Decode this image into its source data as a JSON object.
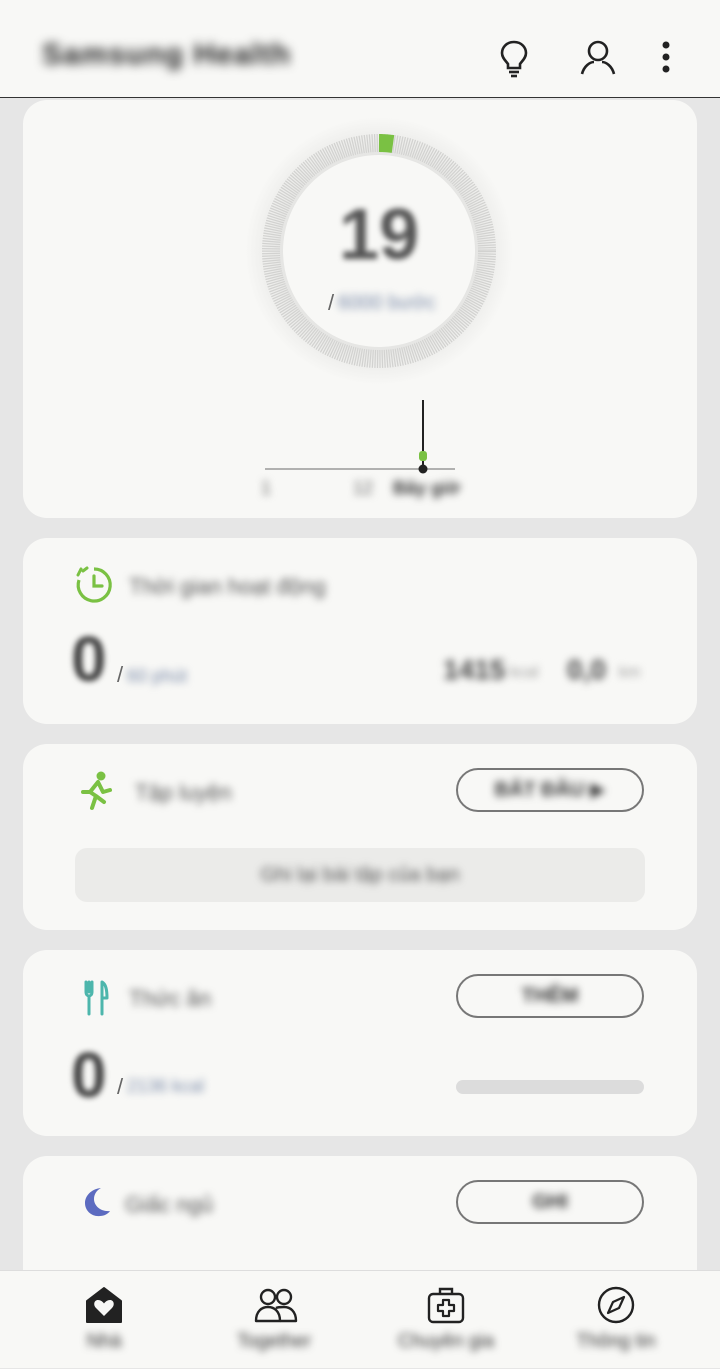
{
  "header": {
    "title": "Samsung Health",
    "icons": [
      "lightbulb-icon",
      "profile-icon",
      "more-vert-icon"
    ]
  },
  "steps_card": {
    "value": "19",
    "goal_sep": "/",
    "goal": "6000 bước",
    "progress_fraction": 0.003,
    "chart_labels": [
      "1",
      "12",
      "Bây giờ"
    ],
    "accent_color": "#7ac143"
  },
  "active_card": {
    "title": "Thời gian hoạt động",
    "value": "0",
    "goal_sep": "/",
    "goal": "60 phút",
    "calories": "1415",
    "calories_unit": "kcal",
    "distance": "0,0",
    "distance_unit": "km",
    "accent_color": "#7ac143"
  },
  "exercise_card": {
    "title": "Tập luyện",
    "start_button": "BẮT ĐẦU ▶",
    "history_button": "Ghi lại bài tập của bạn"
  },
  "food_card": {
    "title": "Thức ăn",
    "record_button": "THÊM",
    "value": "0",
    "goal_sep": "/",
    "goal": "2136 kcal"
  },
  "sleep_card": {
    "title": "Giấc ngủ",
    "record_button": "GHI"
  },
  "nav": {
    "items": [
      {
        "label": "Nhà",
        "icon": "home-heart-icon"
      },
      {
        "label": "Together",
        "icon": "people-icon"
      },
      {
        "label": "Chuyên gia",
        "icon": "medical-kit-icon"
      },
      {
        "label": "Thông tin",
        "icon": "compass-icon"
      }
    ]
  }
}
